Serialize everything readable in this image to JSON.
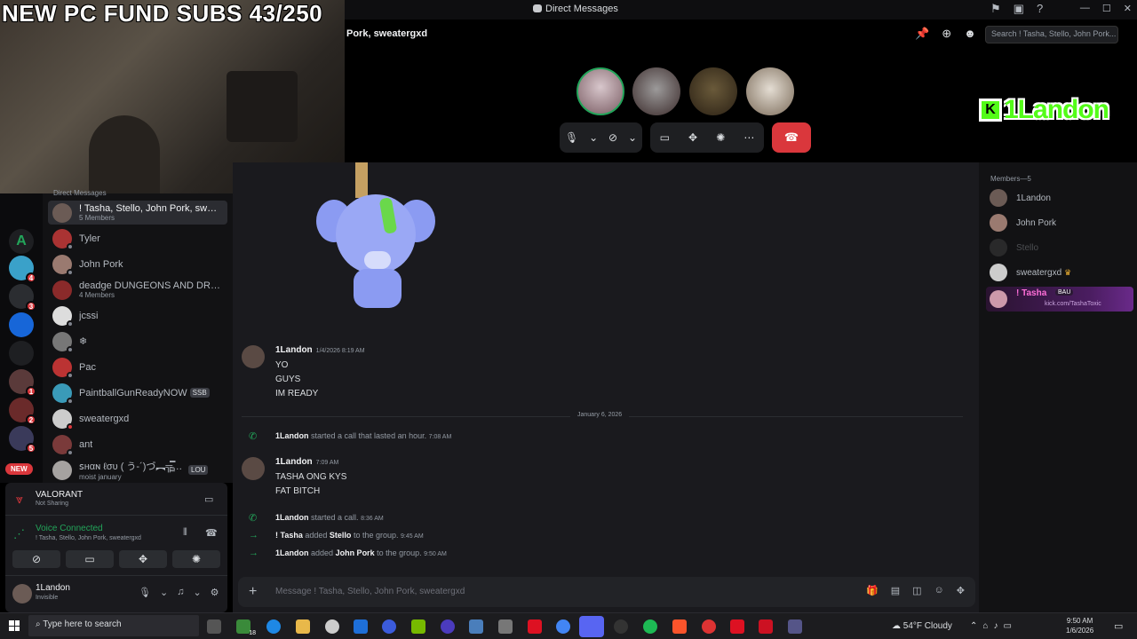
{
  "overlay": {
    "stream_text": "NEW PC FUND SUBS 43/250",
    "kick_badge": "K",
    "kick_name": "1Landon"
  },
  "window": {
    "title": "Direct Messages",
    "min": "—",
    "max": "☐",
    "close": "✕"
  },
  "call": {
    "channel_name": "Pork, sweatergxd",
    "search_placeholder": "Search ! Tasha, Stello, John Pork..."
  },
  "dms": {
    "header": "Direct Messages",
    "items": [
      {
        "name": "! Tasha, Stello, John Pork, sweat...",
        "sub": "5 Members"
      },
      {
        "name": "Tyler",
        "sub": ""
      },
      {
        "name": "John Pork",
        "sub": ""
      },
      {
        "name": "deadge DUNGEONS AND DRAG...",
        "sub": "4 Members"
      },
      {
        "name": "jcssi",
        "sub": ""
      },
      {
        "name": "❄",
        "sub": ""
      },
      {
        "name": "Pac",
        "sub": ""
      },
      {
        "name": "PaintballGunReadyNOW",
        "sub": "",
        "tag": "SSB"
      },
      {
        "name": "sweatergxd",
        "sub": ""
      },
      {
        "name": "ant",
        "sub": ""
      },
      {
        "name": "ꜱнαɴ ℓσυ ( う-´)づ︻╦̵̵͇̿̿̿̿╤──",
        "sub": "moist january",
        "tag": "LOU"
      }
    ]
  },
  "guilds": {
    "badges": [
      "4",
      "3",
      "1",
      "2",
      "5"
    ],
    "new_label": "NEW",
    "a_label": "A"
  },
  "activity": {
    "game": "VALORANT",
    "status": "Not Sharing"
  },
  "voice": {
    "label": "Voice Connected",
    "channel": "! Tasha, Stello, John Pork, sweatergxd"
  },
  "user": {
    "name": "1Landon",
    "status": "Invisible"
  },
  "messages": {
    "m1": {
      "author": "1Landon",
      "time": "1/4/2026 8:19 AM",
      "lines": [
        "YO",
        "GUYS",
        "IM READY"
      ]
    },
    "divider": "January 6, 2026",
    "s1": {
      "actor": "1Landon",
      "text": "started a call that lasted an hour.",
      "time": "7:08 AM"
    },
    "m2": {
      "author": "1Landon",
      "time": "7:09 AM",
      "lines": [
        "TASHA ONG KYS",
        "FAT BITCH"
      ]
    },
    "s2": {
      "actor": "1Landon",
      "text": "started a call.",
      "time": "8:36 AM"
    },
    "s3": {
      "actor": "! Tasha",
      "mid": "added",
      "target": "Stello",
      "tail": "to the group.",
      "time": "9:45 AM"
    },
    "s4": {
      "actor": "1Landon",
      "mid": "added",
      "target": "John Pork",
      "tail": "to the group.",
      "time": "9:50 AM"
    },
    "input_placeholder": "Message ! Tasha, Stello, John Pork, sweatergxd"
  },
  "members": {
    "header": "Members—5",
    "list": [
      {
        "name": "1Landon"
      },
      {
        "name": "John Pork"
      },
      {
        "name": "Stello"
      },
      {
        "name": "sweatergxd",
        "crown": "♛"
      },
      {
        "name": "! Tasha",
        "tag": "BAU",
        "sub": "kick.com/TashaToxic"
      }
    ]
  },
  "taskbar": {
    "search": "Type here to search",
    "weather": "54°F  Cloudy",
    "time": "9:50 AM",
    "date": "1/6/2026",
    "xbox_badge": "18"
  },
  "colors": {
    "accent": "#5865f2",
    "green": "#23a55a",
    "red": "#da373c",
    "bg": "#1a1a1e"
  }
}
